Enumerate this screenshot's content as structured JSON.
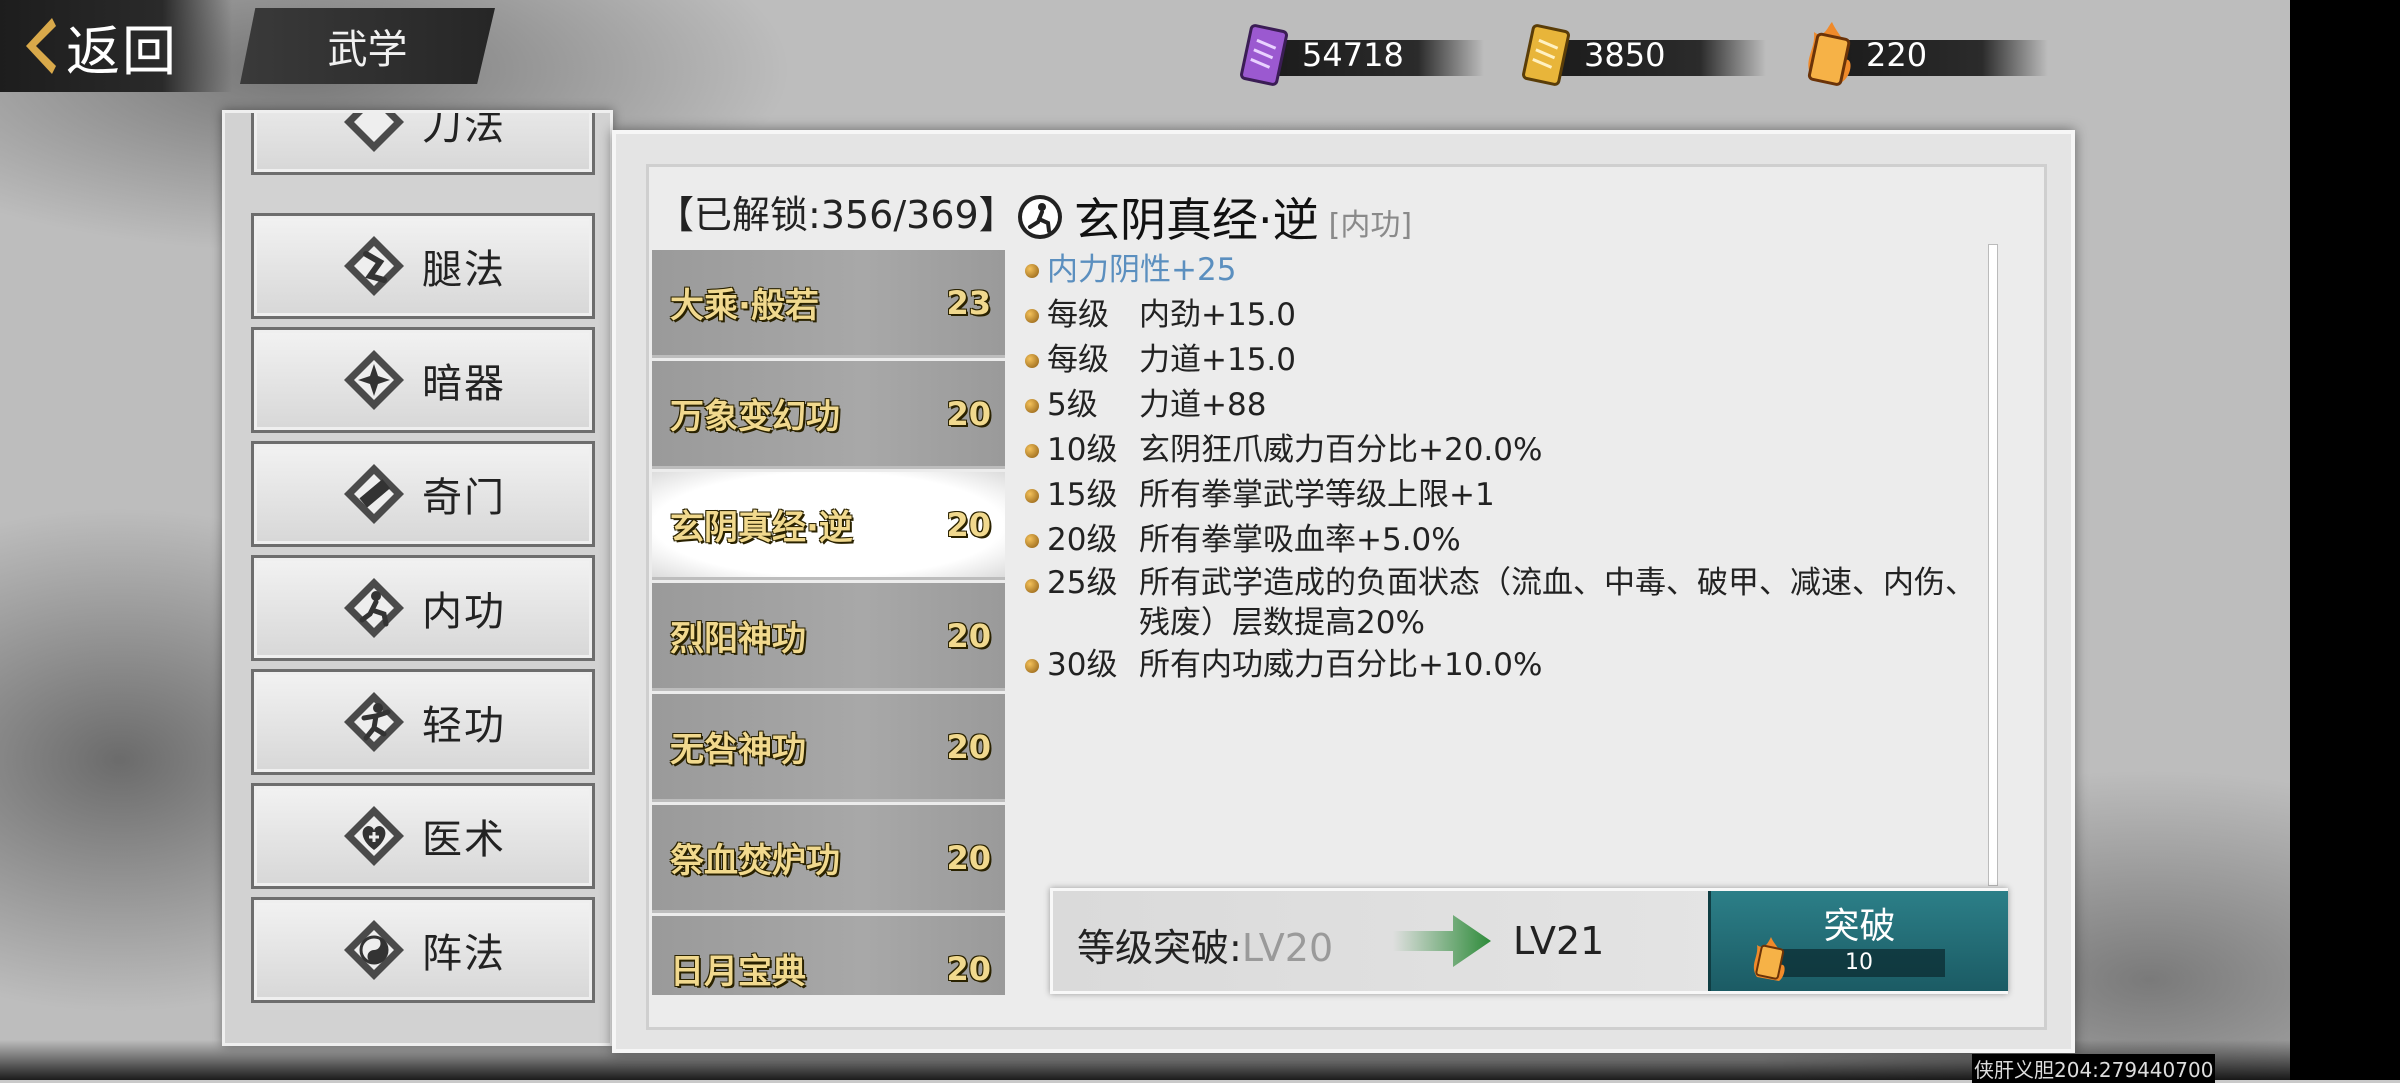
{
  "top_bar": {
    "back_label": "返回",
    "page_title": "武学",
    "currencies": [
      {
        "icon": "purple-scroll-icon",
        "value": "54718",
        "color": "#9b59d0"
      },
      {
        "icon": "gold-scroll-icon",
        "value": "3850",
        "color": "#e8b53a"
      },
      {
        "icon": "orange-scroll-icon",
        "value": "220",
        "color": "#e07a2a"
      }
    ]
  },
  "categories": [
    {
      "label": "刀法",
      "icon": "blade-icon"
    },
    {
      "label": "腿法",
      "icon": "leg-kick-icon"
    },
    {
      "label": "暗器",
      "icon": "shuriken-icon"
    },
    {
      "label": "奇门",
      "icon": "scroll-weapon-icon"
    },
    {
      "label": "内功",
      "icon": "meditation-icon"
    },
    {
      "label": "轻功",
      "icon": "leaping-figure-icon"
    },
    {
      "label": "医术",
      "icon": "medical-heart-icon"
    },
    {
      "label": "阵法",
      "icon": "yin-yang-icon"
    }
  ],
  "unlock_text": "【已解锁:356/369】",
  "skills": [
    {
      "name": "大乘·般若",
      "level": "23"
    },
    {
      "name": "万象变幻功",
      "level": "20"
    },
    {
      "name": "玄阴真经·逆",
      "level": "20",
      "active": true
    },
    {
      "name": "烈阳神功",
      "level": "20"
    },
    {
      "name": "无咎神功",
      "level": "20"
    },
    {
      "name": "祭血焚炉功",
      "level": "20"
    },
    {
      "name": "日月宝典",
      "level": "20"
    }
  ],
  "detail": {
    "name": "玄阴真经·逆",
    "type": "[内功]",
    "bonus": "内力阴性+25",
    "effects": [
      {
        "level": "每级",
        "text": "内劲+15.0"
      },
      {
        "level": "每级",
        "text": "力道+15.0"
      },
      {
        "level": "5级",
        "text": "力道+88"
      },
      {
        "level": "10级",
        "text": "玄阴狂爪威力百分比+20.0%"
      },
      {
        "level": "15级",
        "text": "所有拳掌武学等级上限+1"
      },
      {
        "level": "20级",
        "text": "所有拳掌吸血率+5.0%"
      },
      {
        "level": "25级",
        "text": "所有武学造成的负面状态（流血、中毒、破甲、减速、内伤、残废）层数提高20%"
      },
      {
        "level": "30级",
        "text": "所有内功威力百分比+10.0%"
      }
    ]
  },
  "breakthrough": {
    "label": "等级突破:",
    "current": "LV20",
    "next": "LV21",
    "button_label": "突破",
    "cost": "10"
  },
  "watermark": "侠肝义胆204:279440700"
}
